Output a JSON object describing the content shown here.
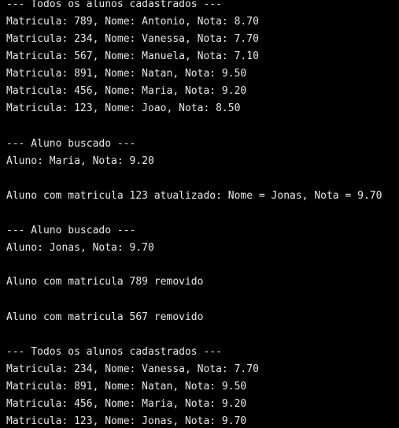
{
  "console": {
    "lines": [
      "--- Todos os alunos cadastrados ---",
      "Matricula: 789, Nome: Antonio, Nota: 8.70",
      "Matricula: 234, Nome: Vanessa, Nota: 7.70",
      "Matricula: 567, Nome: Manuela, Nota: 7.10",
      "Matricula: 891, Nome: Natan, Nota: 9.50",
      "Matricula: 456, Nome: Maria, Nota: 9.20",
      "Matricula: 123, Nome: Joao, Nota: 8.50",
      "--- Aluno buscado ---",
      "Aluno: Maria, Nota: 9.20",
      "Aluno com matricula 123 atualizado: Nome = Jonas, Nota = 9.70",
      "--- Aluno buscado ---",
      "Aluno: Jonas, Nota: 9.70",
      "Aluno com matricula 789 removido",
      "Aluno com matricula 567 removido",
      "--- Todos os alunos cadastrados ---",
      "Matricula: 234, Nome: Vanessa, Nota: 7.70",
      "Matricula: 891, Nome: Natan, Nota: 9.50",
      "Matricula: 456, Nome: Maria, Nota: 9.20",
      "Matricula: 123, Nome: Jonas, Nota: 9.70"
    ]
  },
  "colors": {
    "background": "#000000",
    "text": "#e8e8e8"
  }
}
